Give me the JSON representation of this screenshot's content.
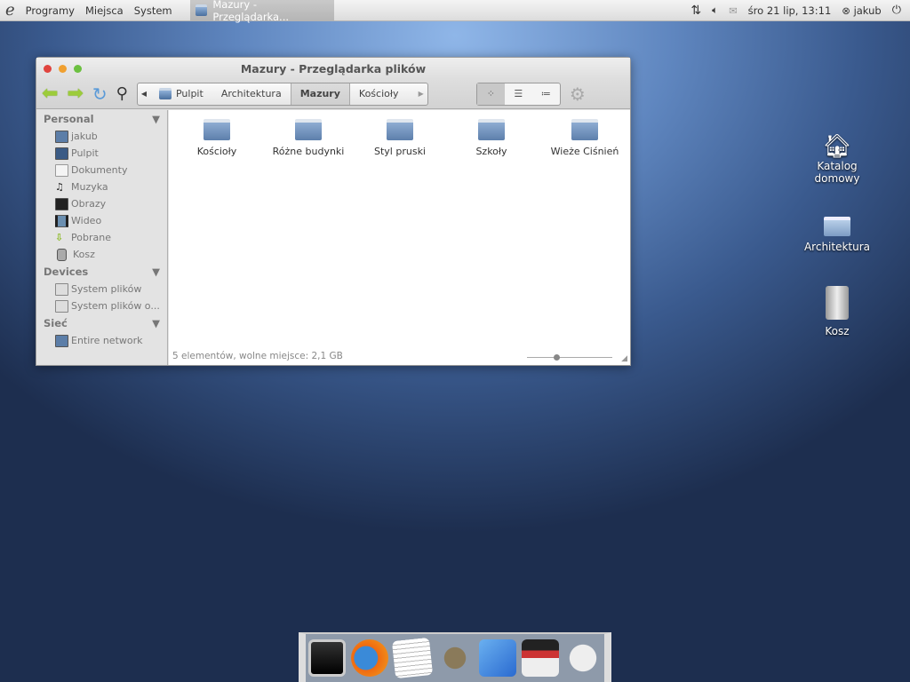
{
  "panel": {
    "menus": [
      "Programy",
      "Miejsca",
      "System"
    ],
    "task": "Mazury - Przeglądarka...",
    "clock": "śro 21 lip, 13:11",
    "user": "jakub"
  },
  "window": {
    "title": "Mazury - Przeglądarka plików",
    "breadcrumbs": [
      "Pulpit",
      "Architektura",
      "Mazury",
      "Kościoły"
    ],
    "active_crumb": "Mazury",
    "sidebar": [
      {
        "header": "Personal",
        "items": [
          "jakub",
          "Pulpit",
          "Dokumenty",
          "Muzyka",
          "Obrazy",
          "Wideo",
          "Pobrane",
          "Kosz"
        ]
      },
      {
        "header": "Devices",
        "items": [
          "System plików",
          "System plików o..."
        ]
      },
      {
        "header": "Sieć",
        "items": [
          "Entire network"
        ]
      }
    ],
    "folders": [
      "Kościoły",
      "Różne budynki",
      "Styl pruski",
      "Szkoły",
      "Wieże Ciśnień"
    ],
    "status": "5 elementów, wolne miejsce: 2,1 GB",
    "view": "icons"
  },
  "desktop": [
    {
      "label": "Katalog domowy",
      "icon": "home-icon"
    },
    {
      "label": "Architektura",
      "icon": "folder-icon"
    },
    {
      "label": "Kosz",
      "icon": "trash-icon"
    }
  ],
  "dock": [
    "terminal",
    "firefox",
    "text-editor",
    "gimp",
    "xcode",
    "video-editor",
    "gamepad"
  ]
}
